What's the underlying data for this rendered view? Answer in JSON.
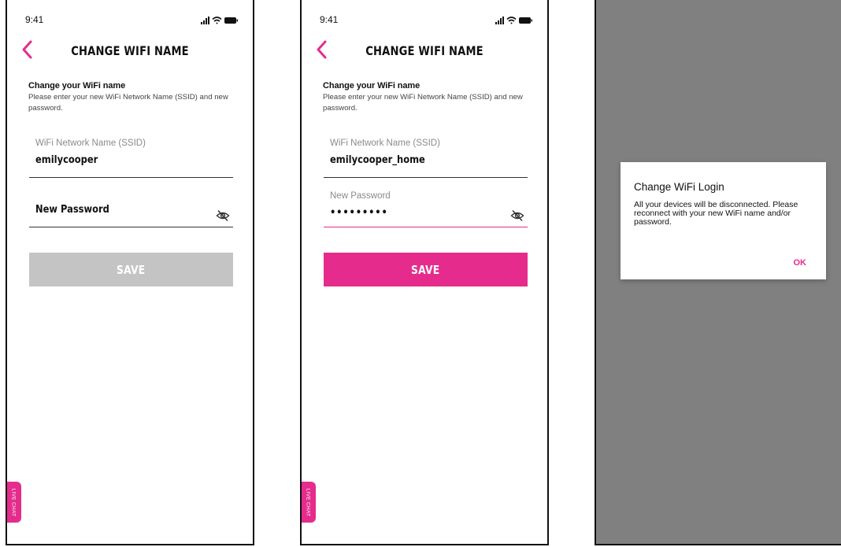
{
  "colors": {
    "accent": "#e52c8c",
    "disabled": "#c4c4c4",
    "overlay": "#808080"
  },
  "status_bar": {
    "time": "9:41"
  },
  "screen1": {
    "title": "CHANGE WIFI NAME",
    "intro_heading": "Change your WiFi name",
    "intro_text": "Please enter your new WiFi Network Name (SSID) and new password.",
    "ssid_label": "WiFi Network Name (SSID)",
    "ssid_value": "emilycooper",
    "password_placeholder": "New Password",
    "save_label": "SAVE",
    "save_state": "disabled",
    "live_chat": "LIVE CHAT"
  },
  "screen2": {
    "title": "CHANGE WIFI NAME",
    "intro_heading": "Change your WiFi name",
    "intro_text": "Please enter your new WiFi Network Name (SSID) and new password.",
    "ssid_label": "WiFi Network Name (SSID)",
    "ssid_value": "emilycooper_home",
    "password_label": "New Password",
    "password_value": "•••••••••",
    "save_label": "SAVE",
    "save_state": "enabled",
    "live_chat": "LIVE CHAT"
  },
  "screen3": {
    "dialog_title": "Change WiFi Login",
    "dialog_body": "All your devices will be disconnected. Please reconnect with your new WiFi name and/or password.",
    "ok_label": "OK"
  },
  "icons": {
    "back": "chevron-left-icon",
    "visibility": "eye-off-icon",
    "signal": "cellular-signal-icon",
    "wifi": "wifi-icon",
    "battery": "battery-icon"
  }
}
